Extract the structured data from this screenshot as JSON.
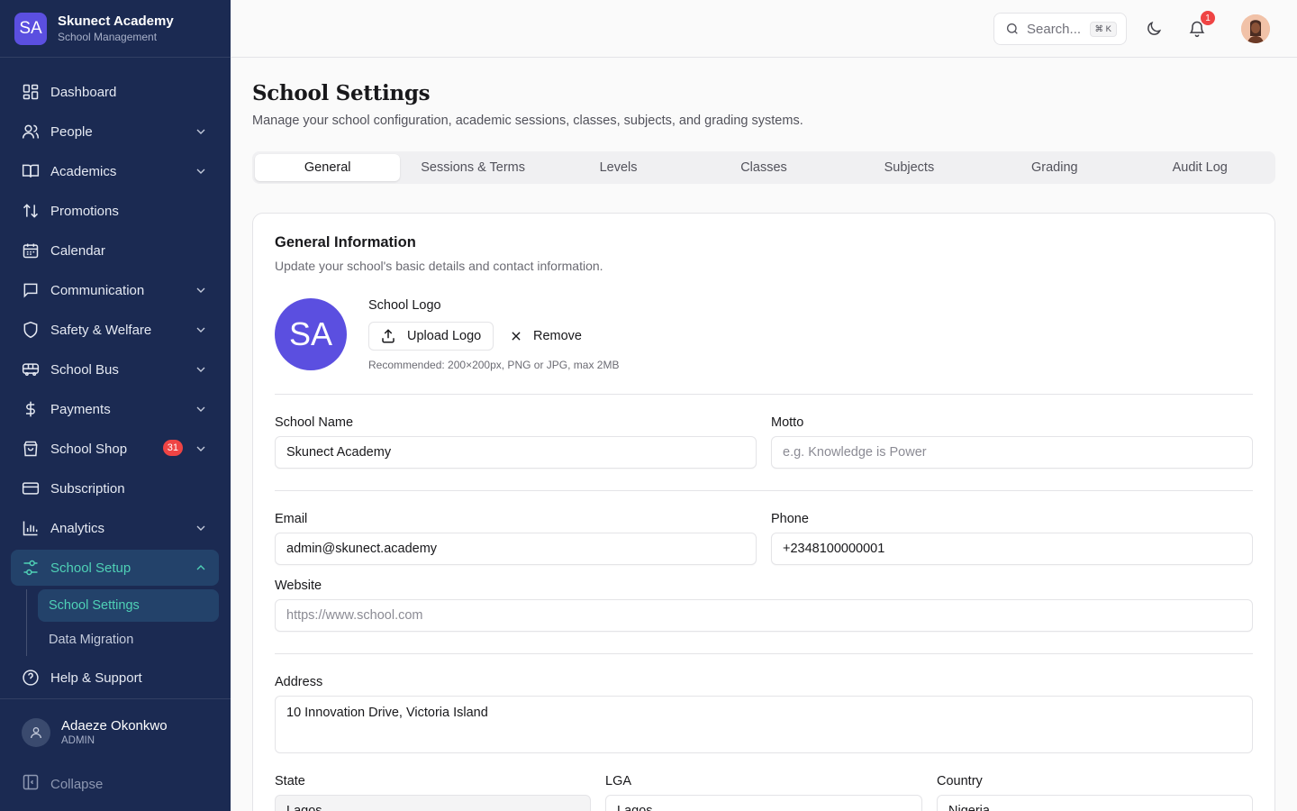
{
  "brand": {
    "initials": "SA",
    "name": "Skunect Academy",
    "subtitle": "School Management"
  },
  "sidebar": {
    "items": [
      {
        "label": "Dashboard",
        "icon": "dashboard-icon"
      },
      {
        "label": "People",
        "icon": "users-icon"
      },
      {
        "label": "Academics",
        "icon": "book-icon"
      },
      {
        "label": "Promotions",
        "icon": "arrows-up-down-icon"
      },
      {
        "label": "Calendar",
        "icon": "calendar-icon"
      },
      {
        "label": "Communication",
        "icon": "message-icon"
      },
      {
        "label": "Safety & Welfare",
        "icon": "shield-icon"
      },
      {
        "label": "School Bus",
        "icon": "bus-icon"
      },
      {
        "label": "Payments",
        "icon": "dollar-icon"
      },
      {
        "label": "School Shop",
        "icon": "shopping-bag-icon",
        "badge": "31"
      },
      {
        "label": "Subscription",
        "icon": "credit-card-icon"
      },
      {
        "label": "Analytics",
        "icon": "bar-chart-icon"
      },
      {
        "label": "School Setup",
        "icon": "sliders-icon"
      },
      {
        "label": "Help & Support",
        "icon": "help-circle-icon"
      }
    ],
    "setup_children": [
      "School Settings",
      "Data Migration"
    ],
    "user": {
      "name": "Adaeze Okonkwo",
      "role": "ADMIN"
    },
    "collapse_label": "Collapse"
  },
  "header": {
    "search_placeholder": "Search...",
    "search_shortcut": "⌘ K",
    "notification_count": "1"
  },
  "page": {
    "title": "School Settings",
    "subtitle": "Manage your school configuration, academic sessions, classes, subjects, and grading systems."
  },
  "tabs": [
    "General",
    "Sessions & Terms",
    "Levels",
    "Classes",
    "Subjects",
    "Grading",
    "Audit Log"
  ],
  "general": {
    "title": "General Information",
    "description": "Update your school's basic details and contact information.",
    "logo_initials": "SA",
    "logo_label": "School Logo",
    "upload_label": "Upload Logo",
    "remove_label": "Remove",
    "logo_hint": "Recommended: 200×200px, PNG or JPG, max 2MB",
    "school_name_label": "School Name",
    "school_name_value": "Skunect Academy",
    "motto_label": "Motto",
    "motto_placeholder": "e.g. Knowledge is Power",
    "email_label": "Email",
    "email_value": "admin@skunect.academy",
    "phone_label": "Phone",
    "phone_value": "+2348100000001",
    "website_label": "Website",
    "website_placeholder": "https://www.school.com",
    "address_label": "Address",
    "address_value": "10 Innovation Drive, Victoria Island",
    "state_label": "State",
    "state_value": "Lagos",
    "lga_label": "LGA",
    "lga_value": "Lagos",
    "country_label": "Country",
    "country_value": "Nigeria"
  },
  "colors": {
    "sidebar_bg": "#1b2a52",
    "accent": "#4fd1b6",
    "brand": "#5b4fe0",
    "badge": "#ef4444"
  }
}
